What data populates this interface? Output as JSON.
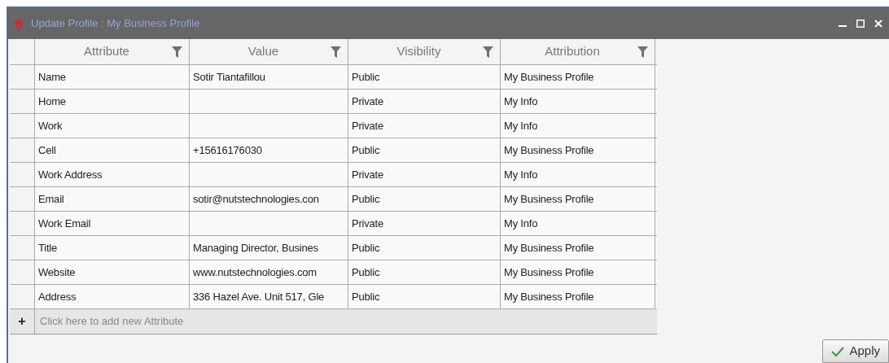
{
  "window": {
    "title": "Update Profile : My Business Profile"
  },
  "table": {
    "columns": [
      {
        "label": "Attribute"
      },
      {
        "label": "Value"
      },
      {
        "label": "Visibility"
      },
      {
        "label": "Attribution"
      }
    ],
    "rows": [
      {
        "cells": [
          "Name",
          "Sotir Tiantafillou",
          "Public",
          "My Business Profile"
        ]
      },
      {
        "cells": [
          "Home",
          "",
          "Private",
          "My Info"
        ]
      },
      {
        "cells": [
          "Work",
          "",
          "Private",
          "My Info"
        ]
      },
      {
        "cells": [
          "Cell",
          "+15616176030",
          "Public",
          "My Business Profile"
        ]
      },
      {
        "cells": [
          "Work Address",
          "",
          "Private",
          "My Info"
        ]
      },
      {
        "cells": [
          "Email",
          "sotir@nutstechnologies.con",
          "Public",
          "My Business Profile"
        ]
      },
      {
        "cells": [
          "Work Email",
          "",
          "Private",
          "My Info"
        ]
      },
      {
        "cells": [
          "Title",
          "Managing Director, Busines",
          "Public",
          "My Business Profile"
        ]
      },
      {
        "cells": [
          "Website",
          "www.nutstechnologies.com",
          "Public",
          "My Business Profile"
        ]
      },
      {
        "cells": [
          "Address",
          "336 Hazel Ave. Unit 517, Gle",
          "Public",
          "My Business Profile"
        ]
      }
    ],
    "add_row": {
      "icon": "+",
      "label": "Click here to add new Attribute"
    }
  },
  "buttons": [
    {
      "label": "Apply"
    }
  ]
}
